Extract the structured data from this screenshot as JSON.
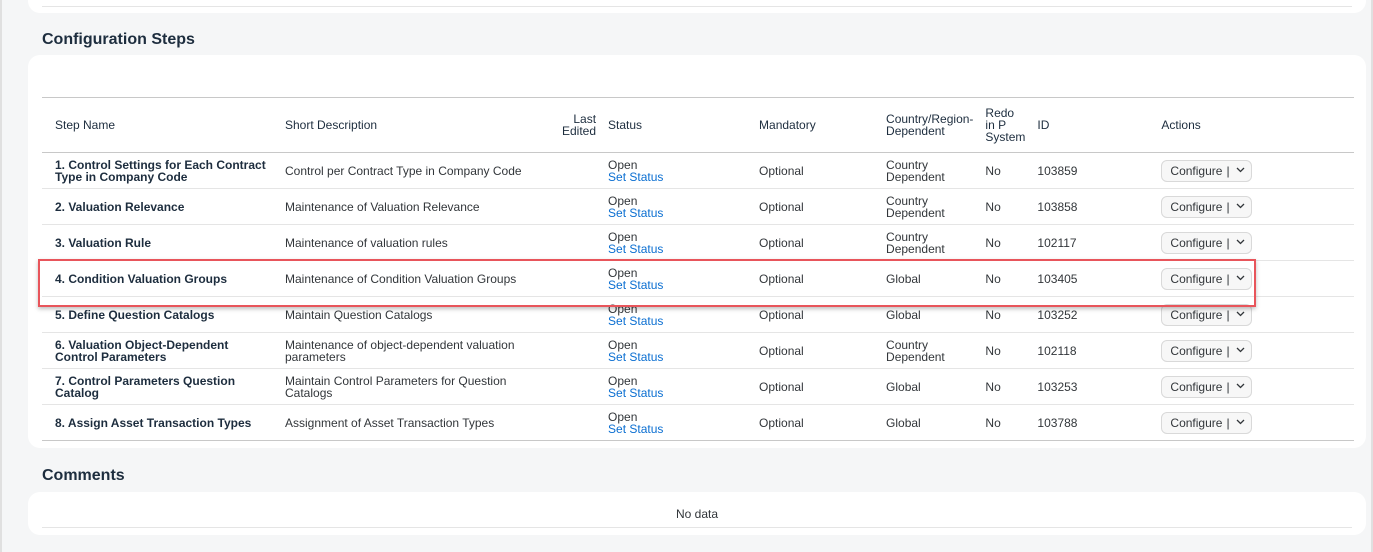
{
  "config_section": {
    "title": "Configuration Steps",
    "columns": [
      "Step Name",
      "Short Description",
      "Last\nEdited",
      "Status",
      "Mandatory",
      "Country/Region-\nDependent",
      "Redo\nin P\nSystem",
      "ID",
      "Actions"
    ],
    "rows": [
      {
        "step": "1. Control Settings for Each Contract Type in Company Code",
        "desc": "Control per Contract Type in Company Code",
        "last_edited": "",
        "status": "Open",
        "set_status": "Set Status",
        "mandatory": "Optional",
        "country": "Country Dependent",
        "redo": "No",
        "id": "103859",
        "action": "Configure"
      },
      {
        "step": "2. Valuation Relevance",
        "desc": "Maintenance of Valuation Relevance",
        "last_edited": "",
        "status": "Open",
        "set_status": "Set Status",
        "mandatory": "Optional",
        "country": "Country Dependent",
        "redo": "No",
        "id": "103858",
        "action": "Configure"
      },
      {
        "step": "3. Valuation Rule",
        "desc": "Maintenance of valuation rules",
        "last_edited": "",
        "status": "Open",
        "set_status": "Set Status",
        "mandatory": "Optional",
        "country": "Country Dependent",
        "redo": "No",
        "id": "102117",
        "action": "Configure"
      },
      {
        "step": "4. Condition Valuation Groups",
        "desc": "Maintenance of Condition Valuation Groups",
        "last_edited": "",
        "status": "Open",
        "set_status": "Set Status",
        "mandatory": "Optional",
        "country": "Global",
        "redo": "No",
        "id": "103405",
        "action": "Configure"
      },
      {
        "step": "5. Define Question Catalogs",
        "desc": "Maintain Question Catalogs",
        "last_edited": "",
        "status": "Open",
        "set_status": "Set Status",
        "mandatory": "Optional",
        "country": "Global",
        "redo": "No",
        "id": "103252",
        "action": "Configure"
      },
      {
        "step": "6. Valuation Object-Dependent Control Parameters",
        "desc": "Maintenance of object-dependent valuation parameters",
        "last_edited": "",
        "status": "Open",
        "set_status": "Set Status",
        "mandatory": "Optional",
        "country": "Country Dependent",
        "redo": "No",
        "id": "102118",
        "action": "Configure"
      },
      {
        "step": "7. Control Parameters Question Catalog",
        "desc": "Maintain Control Parameters for Question Catalogs",
        "last_edited": "",
        "status": "Open",
        "set_status": "Set Status",
        "mandatory": "Optional",
        "country": "Global",
        "redo": "No",
        "id": "103253",
        "action": "Configure"
      },
      {
        "step": "8. Assign Asset Transaction Types",
        "desc": "Assignment of Asset Transaction Types",
        "last_edited": "",
        "status": "Open",
        "set_status": "Set Status",
        "mandatory": "Optional",
        "country": "Global",
        "redo": "No",
        "id": "103788",
        "action": "Configure"
      }
    ]
  },
  "comments_section": {
    "title": "Comments",
    "empty_text": "No data"
  },
  "icons": {
    "dropdown": "chevron-down-icon"
  },
  "colors": {
    "link": "#0a6ed1",
    "highlight": "#e8555b",
    "background": "#f5f6f7"
  }
}
